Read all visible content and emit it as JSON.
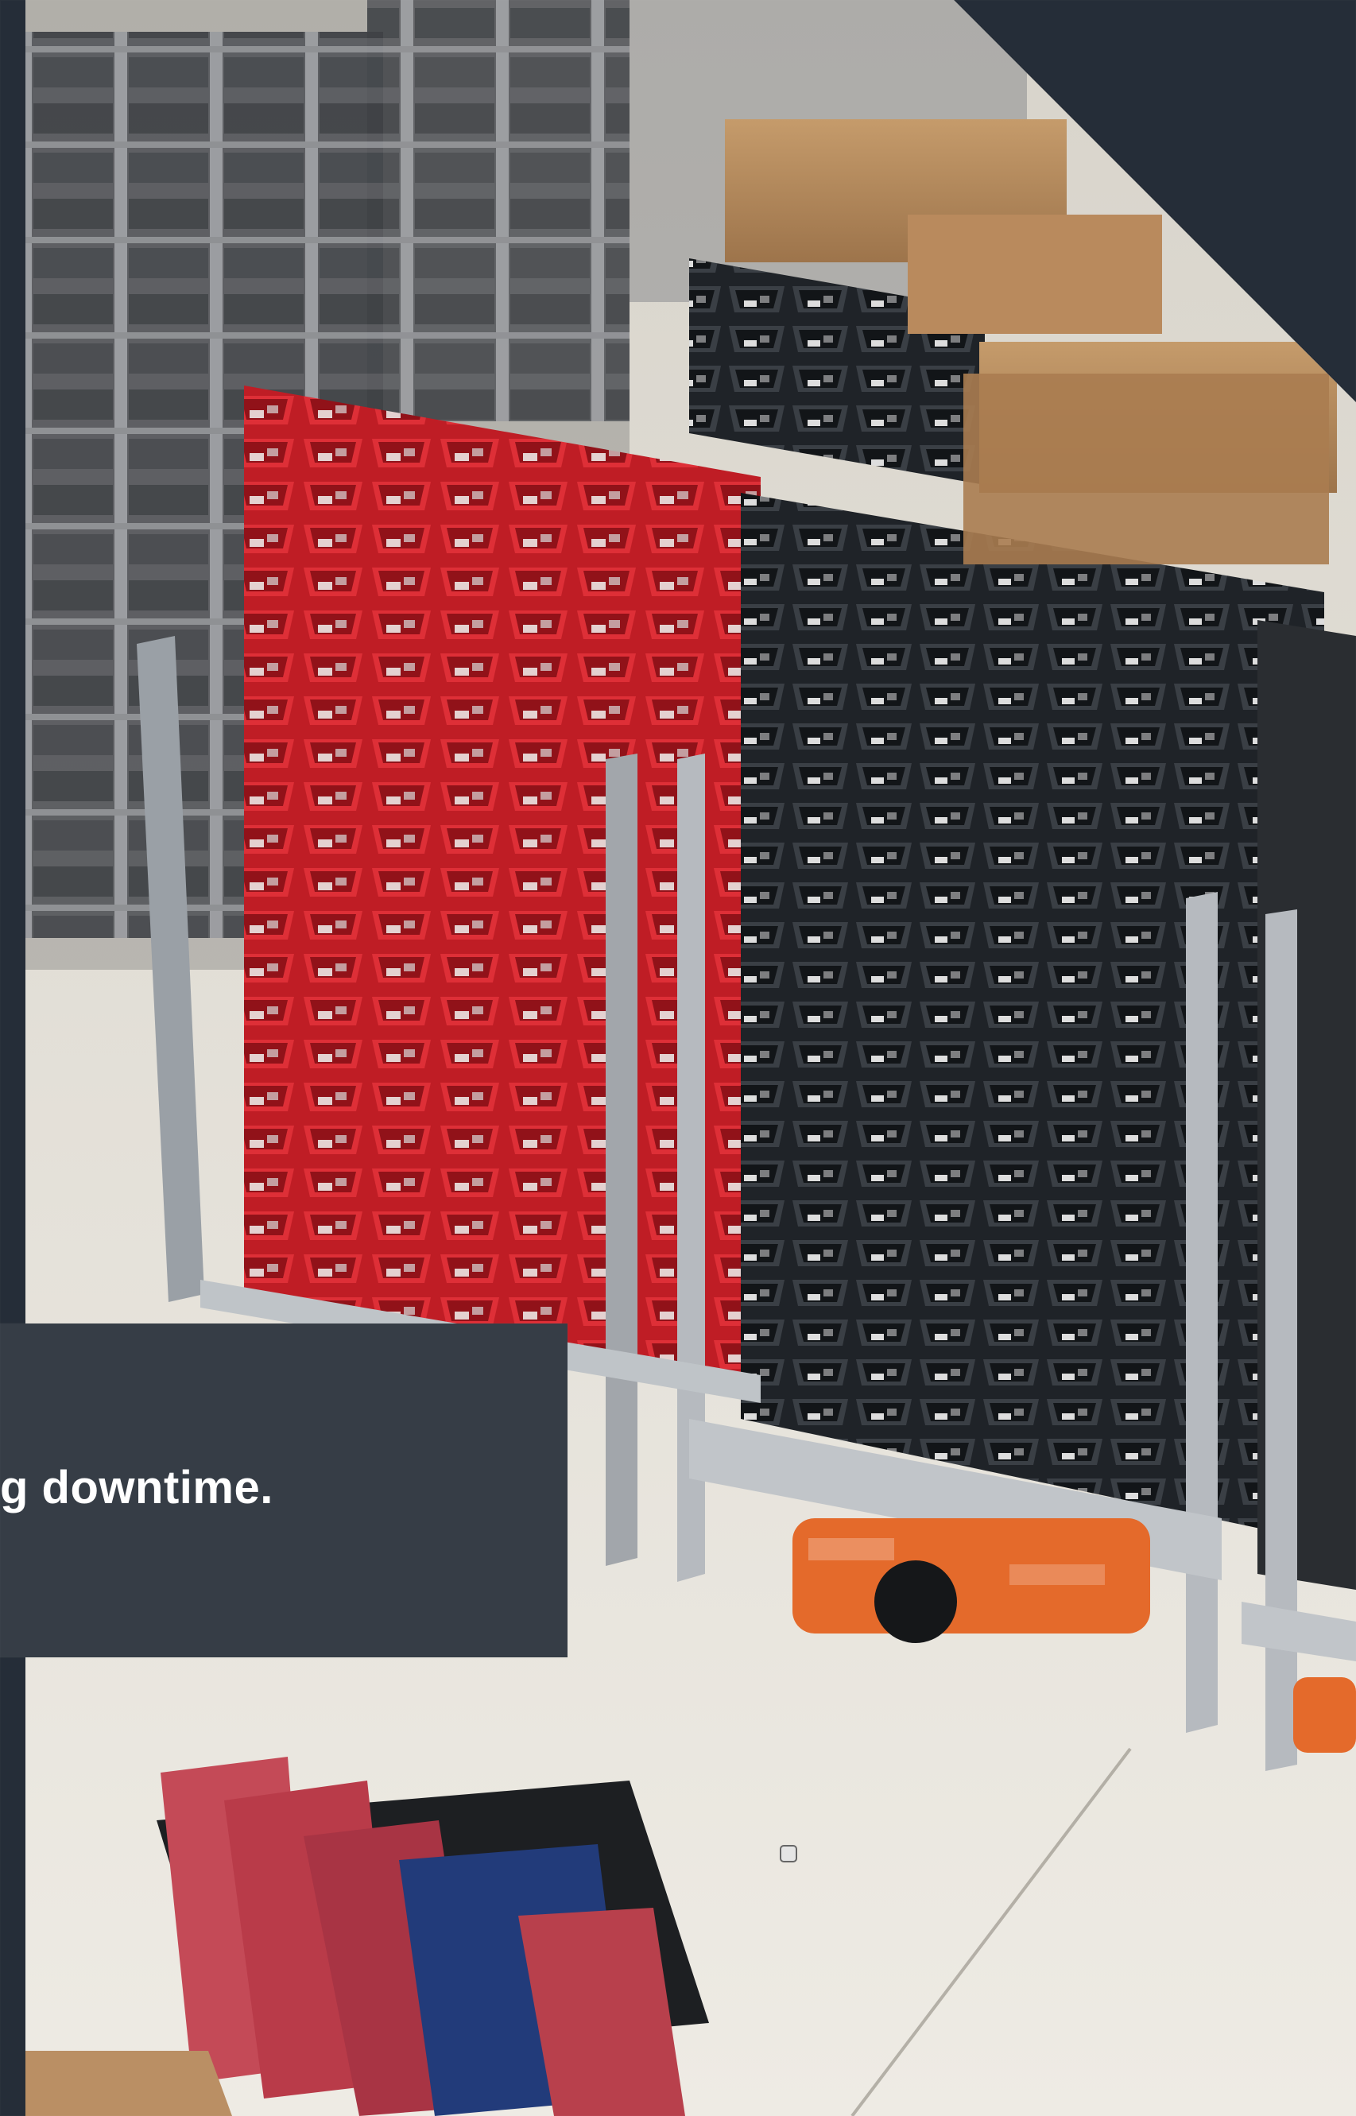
{
  "caption": {
    "text": "g downtime."
  },
  "colors": {
    "background": "#252d38",
    "card": "#363d46",
    "text": "#ffffff",
    "red_bins": "#c31b27",
    "dark_bins": "#2f3338",
    "robot_orange": "#e46a2b",
    "floor": "#e9e6de"
  }
}
